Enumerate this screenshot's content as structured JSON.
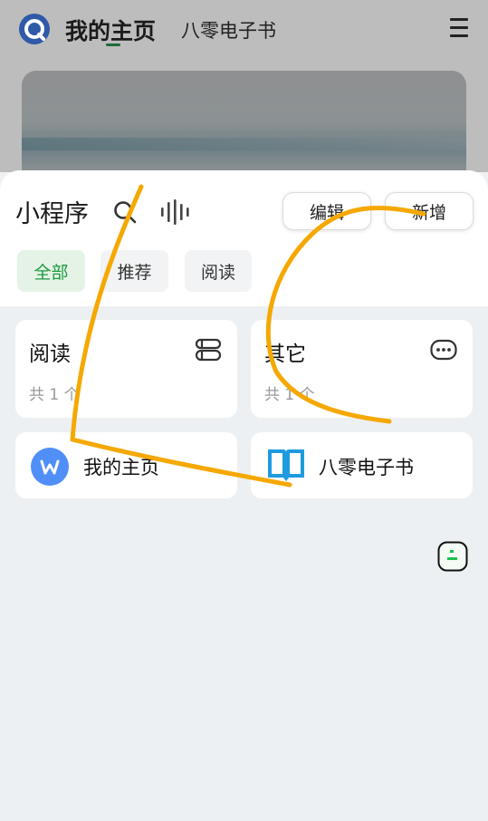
{
  "topbar": {
    "title": "我的主页",
    "subtitle": "八零电子书"
  },
  "sheet": {
    "title": "小程序",
    "edit_label": "编辑",
    "add_label": "新增",
    "tabs": [
      {
        "label": "全部",
        "active": true
      },
      {
        "label": "推荐",
        "active": false
      },
      {
        "label": "阅读",
        "active": false
      }
    ],
    "categories": [
      {
        "name": "阅读",
        "count": "共 1 个",
        "icon": "book-stack-icon"
      },
      {
        "name": "其它",
        "count": "共 1 个",
        "icon": "more-icon"
      }
    ],
    "apps": [
      {
        "name": "我的主页",
        "icon": "w-logo-icon"
      },
      {
        "name": "八零电子书",
        "icon": "open-book-icon"
      }
    ]
  },
  "colors": {
    "accent_green": "#1d9a3f",
    "tab_active_bg": "#e5f3e7",
    "scribble": "#f5a800",
    "w_logo": "#4f8ff7",
    "book_blue": "#1e9be0"
  }
}
